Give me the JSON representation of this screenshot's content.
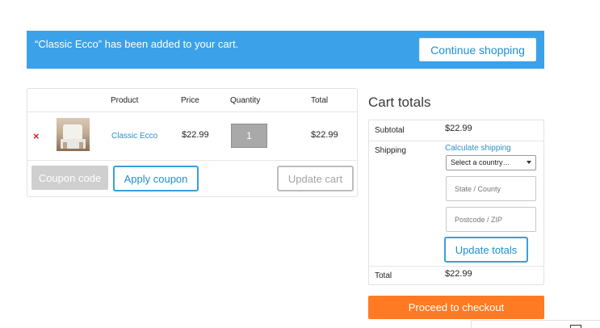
{
  "notice": {
    "message": "“Classic Ecco” has been added to your cart.",
    "button": "Continue shopping"
  },
  "cart": {
    "headers": {
      "product": "Product",
      "price": "Price",
      "quantity": "Quantity",
      "total": "Total"
    },
    "item": {
      "remove_symbol": "×",
      "name": "Classic Ecco",
      "price": "$22.99",
      "quantity": "1",
      "total": "$22.99"
    },
    "coupon_placeholder": "Coupon code",
    "apply_coupon": "Apply coupon",
    "update_cart": "Update cart"
  },
  "totals": {
    "title": "Cart totals",
    "subtotal_label": "Subtotal",
    "subtotal_value": "$22.99",
    "shipping_label": "Shipping",
    "calculate_shipping": "Calculate shipping",
    "country_select": "Select a country…",
    "state_placeholder": "State / County",
    "postcode_placeholder": "Postcode / ZIP",
    "update_totals": "Update totals",
    "total_label": "Total",
    "total_value": "$22.99",
    "checkout": "Proceed to checkout"
  },
  "colors": {
    "notice_bg": "#3ba2e9",
    "link_blue": "#1e8fd0",
    "remove_red": "#e02020",
    "checkout_orange": "#ff7a22"
  }
}
